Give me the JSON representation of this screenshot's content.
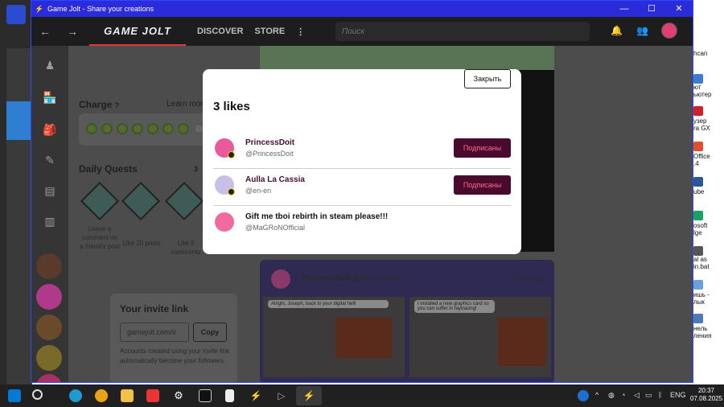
{
  "window": {
    "title": "Game Jolt - Share your creations",
    "controls": {
      "minimize": "—",
      "maximize": "☐",
      "close": "✕"
    }
  },
  "nav": {
    "back": "←",
    "forward": "→",
    "logo": "GAME JOLT",
    "discover": "DISCOVER",
    "store": "STORE",
    "more": "⋮",
    "search_placeholder": "Поиск"
  },
  "sidebar": {
    "charge_title": "Charge",
    "charge_help": "?",
    "learn_more": "Learn more",
    "quests_title": "Daily Quests",
    "quests_count": "3",
    "quests": [
      {
        "label": "Leave a comment on a friend's post"
      },
      {
        "label": "Like 20 posts"
      },
      {
        "label": "Like 5 comments"
      }
    ],
    "invite_title": "Your invite link",
    "invite_value": "gamejolt.com/ir",
    "copy_label": "Copy",
    "invite_note": "Accounts created using your invite link automatically become your followers."
  },
  "post": {
    "author": "PrincessDoit",
    "handle": "@PrincessDoit",
    "time": "11 minutes",
    "bubble1": "Alright, Joseph, back to your digital hell!",
    "bubble2": "I installed a new graphics card so you can suffer in raytracing!"
  },
  "modal": {
    "close_label": "Закрыть",
    "title": "3 likes",
    "likes": [
      {
        "name": "PrincessDoit",
        "handle": "@PrincessDoit",
        "button": "Подписаны",
        "avatar_color": "#e85a9a"
      },
      {
        "name": "Aulla La Cassia",
        "handle": "@en-en",
        "button": "Подписаны",
        "avatar_color": "#c8c0e8"
      },
      {
        "name": "Gift me tboi rebirth in steam please!!!",
        "handle": "@MaGRoNOfficial",
        "button": "",
        "avatar_color": "#f06aa0"
      }
    ]
  },
  "desktop": {
    "labels": [
      "hcan",
      "ют\nьютер",
      "узер\nra GX",
      "Office\n.4",
      "ube",
      "osoft\nlge",
      "al as\nin.bat",
      "ишь -\nлык",
      "нель\nления"
    ]
  },
  "taskbar": {
    "lang": "ENG",
    "time": "20:37",
    "date": "07.08.2025"
  },
  "colors": {
    "accent_red": "#e5383b",
    "follow_bg": "#4a0a2e",
    "follow_text": "#ff6a8e",
    "titlebar": "#2a2bd9"
  }
}
